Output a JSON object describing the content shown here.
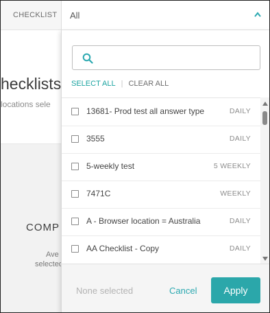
{
  "filter": {
    "label": "CHECKLIST",
    "selected_value": "All",
    "chevron_icon": "chevron-up-icon"
  },
  "background": {
    "title": "hecklists",
    "subtitle": "locations sele",
    "comp": "COMP",
    "ave": "Ave",
    "selected": "selected"
  },
  "dropdown": {
    "search": {
      "placeholder": "",
      "value": "",
      "icon": "search-icon"
    },
    "select_all": "SELECT ALL",
    "clear_all": "CLEAR ALL",
    "items": [
      {
        "name": "13681- Prod test all answer type",
        "frequency": "DAILY",
        "checked": false
      },
      {
        "name": "3555",
        "frequency": "DAILY",
        "checked": false
      },
      {
        "name": "5-weekly test",
        "frequency": "5 WEEKLY",
        "checked": false
      },
      {
        "name": "7471C",
        "frequency": "WEEKLY",
        "checked": false
      },
      {
        "name": "A - Browser location = Australia",
        "frequency": "DAILY",
        "checked": false
      },
      {
        "name": "AA Checklist - Copy",
        "frequency": "DAILY",
        "checked": false
      }
    ],
    "footer": {
      "status": "None selected",
      "cancel_label": "Cancel",
      "apply_label": "Apply"
    }
  },
  "colors": {
    "accent": "#2ba7aa",
    "link": "#1aa3a0"
  }
}
